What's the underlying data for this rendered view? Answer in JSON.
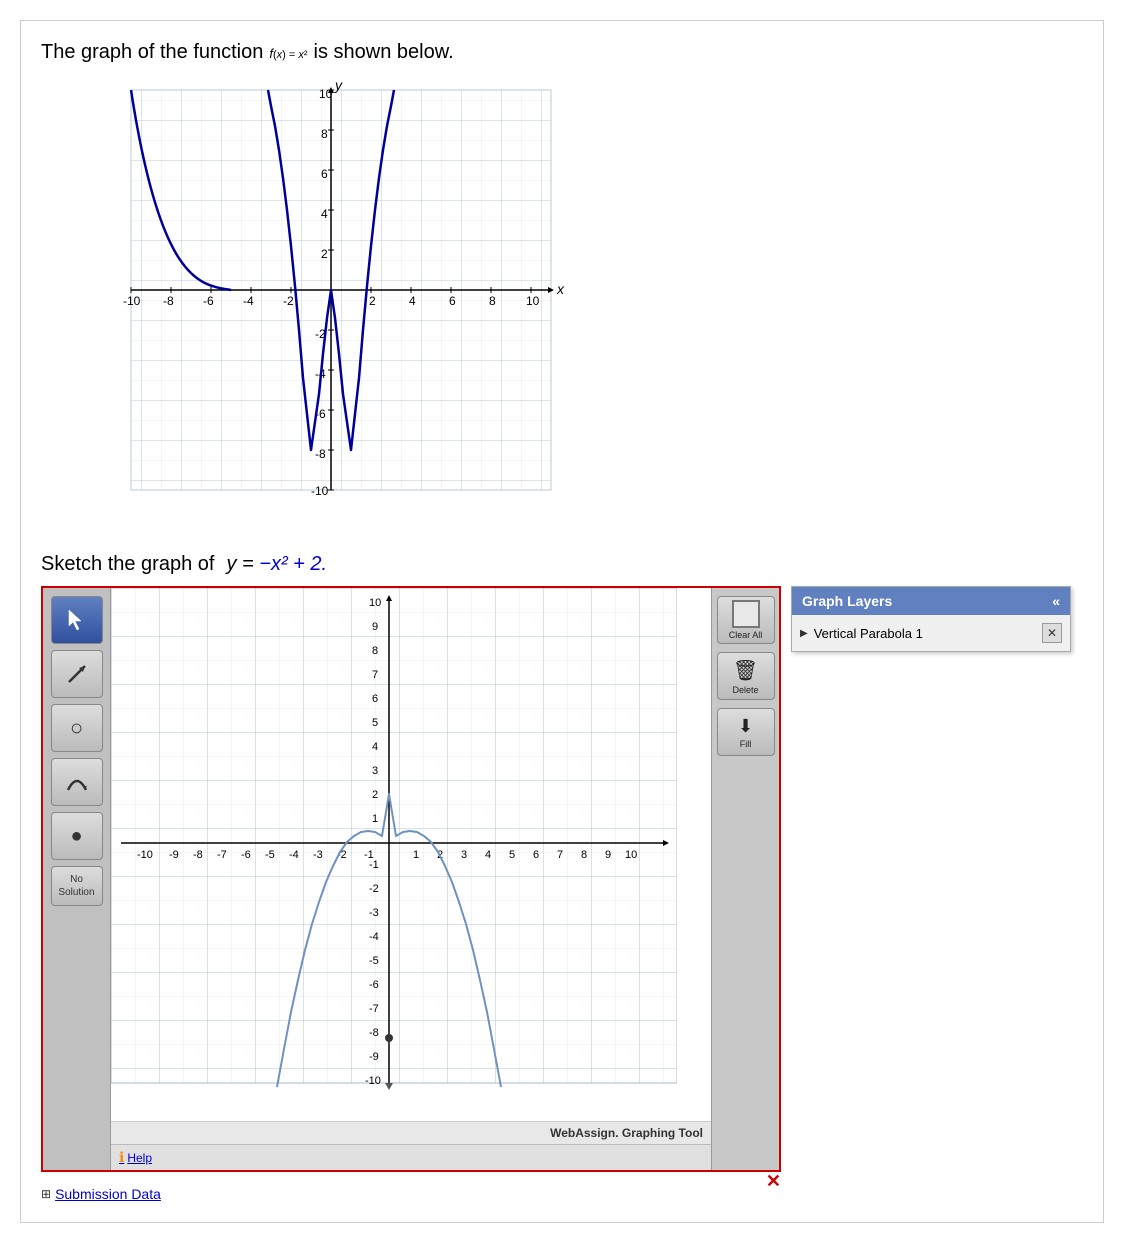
{
  "problem": {
    "intro": "The graph of the function",
    "func_label": "f(x) = x²",
    "is_shown": "is shown below."
  },
  "sketch": {
    "label": "Sketch the graph of",
    "equation": "y = −x² + 2."
  },
  "toolbar": {
    "tools": [
      {
        "name": "pointer",
        "icon": "▲",
        "active": true
      },
      {
        "name": "line",
        "icon": "↗",
        "active": false
      },
      {
        "name": "circle",
        "icon": "○",
        "active": false
      },
      {
        "name": "parabola",
        "icon": "∪",
        "active": false
      },
      {
        "name": "point",
        "icon": "●",
        "active": false
      },
      {
        "name": "no-solution",
        "label": "No\nSolution",
        "active": false
      }
    ]
  },
  "side_panel": {
    "buttons": [
      {
        "name": "clear-all",
        "label": "Clear All"
      },
      {
        "name": "delete",
        "label": "Delete",
        "icon": "🗑"
      },
      {
        "name": "fill",
        "label": "Fill",
        "icon": "⬇"
      }
    ]
  },
  "graph_layers": {
    "title": "Graph Layers",
    "collapse_icon": "«",
    "layers": [
      {
        "name": "Vertical Parabola 1"
      }
    ]
  },
  "footer": {
    "webassign": "WebAssign.",
    "tool_label": "Graphing Tool"
  },
  "help": {
    "label": "Help"
  },
  "submission": {
    "label": "Submission Data"
  },
  "axes": {
    "x_label": "x",
    "y_label": "y",
    "static_x_vals": [
      "-10",
      "-8",
      "-6",
      "-4",
      "-2",
      "2",
      "4",
      "6",
      "8",
      "10"
    ],
    "static_y_vals": [
      "10",
      "8",
      "6",
      "4",
      "2",
      "-2",
      "-4",
      "-6",
      "-8",
      "-10"
    ],
    "interactive_x_vals": [
      "-10",
      "-9",
      "-8",
      "-7",
      "-6",
      "-5",
      "-4",
      "-3",
      "-2",
      "-1",
      "1",
      "2",
      "3",
      "4",
      "5",
      "6",
      "7",
      "8",
      "9",
      "10"
    ],
    "interactive_y_vals": [
      "10",
      "9",
      "8",
      "7",
      "6",
      "5",
      "4",
      "3",
      "2",
      "1",
      "-1",
      "-2",
      "-3",
      "-4",
      "-5",
      "-6",
      "-7",
      "-8",
      "-9",
      "-10"
    ]
  }
}
